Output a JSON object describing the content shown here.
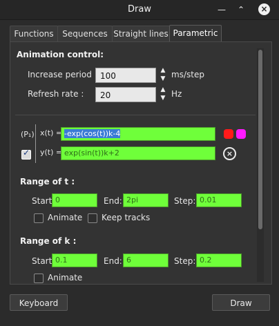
{
  "window": {
    "title": "Draw"
  },
  "tabs": [
    {
      "label": "Functions"
    },
    {
      "label": "Sequences"
    },
    {
      "label": "Straight lines"
    },
    {
      "label": "Parametric"
    }
  ],
  "animation": {
    "heading": "Animation control:",
    "increase_label": "Increase period :",
    "increase_value": "100",
    "increase_unit": "ms/step",
    "refresh_label": "Refresh rate :",
    "refresh_value": "20",
    "refresh_unit": "Hz"
  },
  "curve": {
    "name": "(P₁)",
    "x_label": "x(t) =",
    "x_expr": "-exp(cos(t))k-4",
    "y_label": "y(t) =",
    "y_expr": "exp(sin(t))k+2",
    "color1": "#ff1a1a",
    "color2": "#ff1aff"
  },
  "range_t": {
    "heading": "Range of t :",
    "start_label": "Start:",
    "start": "0",
    "end_label": "End:",
    "end": "2pi",
    "step_label": "Step:",
    "step": "0.01",
    "animate_label": "Animate",
    "keep_tracks_label": "Keep tracks"
  },
  "range_k": {
    "heading": "Range of k :",
    "start_label": "Start:",
    "start": "0.1",
    "end_label": "End:",
    "end": "6",
    "step_label": "Step:",
    "step": "0.2",
    "animate_label": "Animate"
  },
  "footer": {
    "keyboard_label": "Keyboard",
    "draw_label": "Draw"
  }
}
